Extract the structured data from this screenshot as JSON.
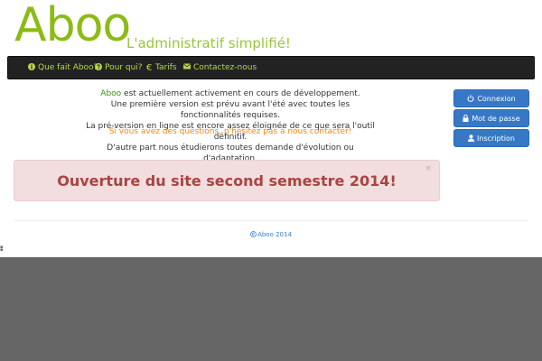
{
  "header": {
    "logo": "Aboo",
    "tagline": "L'administratif simplifié!"
  },
  "nav": {
    "items": [
      {
        "label": "Que fait Aboo?",
        "icon": "info-icon"
      },
      {
        "label": "Pour qui?",
        "icon": "question-icon"
      },
      {
        "label": "Tarifs",
        "icon": "euro-icon"
      },
      {
        "label": "Contactez-nous",
        "icon": "envelope-icon"
      }
    ]
  },
  "main": {
    "brand_name": "Aboo",
    "line1_rest": " est actuellement activement en cours de développement.",
    "line2": "Une première version est prévu avant l'été avec toutes les fonctionnalités requises.",
    "line3": "La pré-version en ligne est encore assez éloignée de ce que sera l'outil définitif.",
    "contact_line": "Si vous avez des questions, n'hésitez pas à nous contacter!",
    "evolution_line": "D'autre part nous étudierons toutes demande d'évolution ou d'adaptation."
  },
  "sidebar": {
    "buttons": [
      {
        "label": "Connexion",
        "icon": "power-icon"
      },
      {
        "label": "Mot de passe",
        "icon": "lock-icon"
      },
      {
        "label": "Inscription",
        "icon": "user-icon"
      }
    ]
  },
  "alert": {
    "message": "Ouverture du site second semestre 2014!",
    "close": "×"
  },
  "footer": {
    "copyright": "Aboo 2014"
  },
  "colors": {
    "brand_green": "#8cbb16",
    "nav_bg": "#222222",
    "button_blue": "#3778c6",
    "alert_bg": "#f2dede",
    "alert_text": "#a94442",
    "link_orange": "#ee8a1b",
    "footer_blue": "#3a7fc1",
    "lower_gray": "#666666"
  }
}
